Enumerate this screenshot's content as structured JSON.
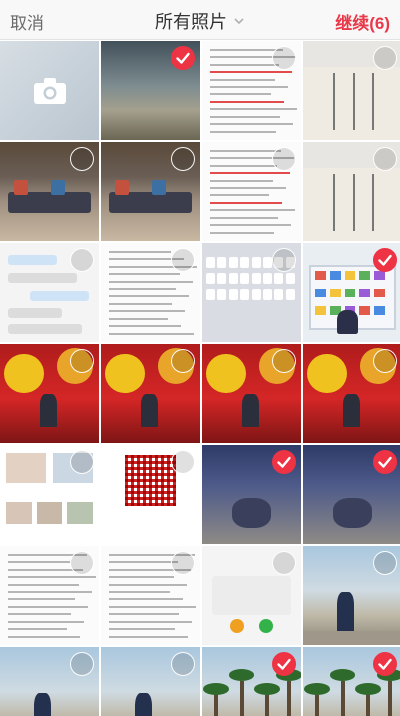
{
  "header": {
    "cancel_label": "取消",
    "title": "所有照片",
    "continue_label": "继续(6)",
    "accent_color": "#e8394a"
  },
  "grid": {
    "columns": 4,
    "cells": [
      {
        "kind": "camera",
        "icon": "camera-icon",
        "selectable": false
      },
      {
        "kind": "glass-door",
        "selectable": true,
        "checked": true
      },
      {
        "kind": "document",
        "selectable": true,
        "checked": false
      },
      {
        "kind": "poster",
        "selectable": true,
        "checked": false
      },
      {
        "kind": "room",
        "selectable": true,
        "checked": false
      },
      {
        "kind": "room",
        "selectable": true,
        "checked": false
      },
      {
        "kind": "document",
        "selectable": true,
        "checked": false
      },
      {
        "kind": "poster",
        "selectable": true,
        "checked": false
      },
      {
        "kind": "chat",
        "selectable": true,
        "checked": false
      },
      {
        "kind": "article",
        "selectable": true,
        "checked": false
      },
      {
        "kind": "keyboard",
        "selectable": true,
        "checked": false
      },
      {
        "kind": "bookshelf",
        "selectable": true,
        "checked": true
      },
      {
        "kind": "festival",
        "selectable": true,
        "checked": false
      },
      {
        "kind": "festival",
        "selectable": true,
        "checked": false
      },
      {
        "kind": "festival",
        "selectable": true,
        "checked": false
      },
      {
        "kind": "festival",
        "selectable": true,
        "checked": false
      },
      {
        "kind": "app-feed",
        "selectable": true,
        "checked": false
      },
      {
        "kind": "qr-code",
        "selectable": true,
        "checked": false
      },
      {
        "kind": "airplane",
        "selectable": true,
        "checked": true
      },
      {
        "kind": "airplane",
        "selectable": true,
        "checked": true
      },
      {
        "kind": "list",
        "selectable": true,
        "checked": false
      },
      {
        "kind": "article",
        "selectable": true,
        "checked": false
      },
      {
        "kind": "phone-dialog",
        "selectable": true,
        "checked": false
      },
      {
        "kind": "seaside",
        "selectable": true,
        "checked": false
      },
      {
        "kind": "seaside",
        "selectable": true,
        "checked": false
      },
      {
        "kind": "seaside",
        "selectable": true,
        "checked": false
      },
      {
        "kind": "palms",
        "selectable": true,
        "checked": true
      },
      {
        "kind": "palms",
        "selectable": true,
        "checked": true
      }
    ]
  }
}
